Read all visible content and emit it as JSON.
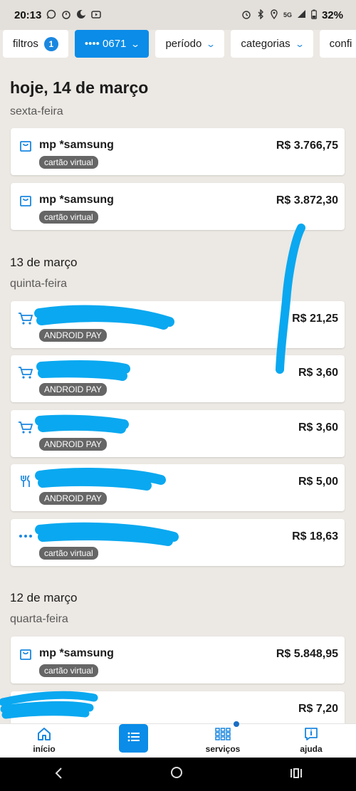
{
  "status_bar": {
    "time": "20:13",
    "network": "5G",
    "battery": "32%"
  },
  "filters": [
    {
      "label": "filtros",
      "count": "1"
    },
    {
      "label": "•••• 0671"
    },
    {
      "label": "período"
    },
    {
      "label": "categorias"
    },
    {
      "label": "confi"
    }
  ],
  "days": [
    {
      "title": "hoje, 14 de março",
      "weekday": "sexta-feira",
      "transactions": [
        {
          "icon": "shopping-bag-icon",
          "merchant": "mp *samsung",
          "amount": "R$ 3.766,75",
          "tag": "cartão virtual"
        },
        {
          "icon": "shopping-bag-icon",
          "merchant": "mp *samsung",
          "amount": "R$ 3.872,30",
          "tag": "cartão virtual"
        }
      ]
    },
    {
      "title": "13 de março",
      "weekday": "quinta-feira",
      "transactions": [
        {
          "icon": "shopping-cart-icon",
          "merchant": "",
          "amount": "R$ 21,25",
          "tag": "ANDROID PAY"
        },
        {
          "icon": "shopping-cart-icon",
          "merchant": "",
          "amount": "R$ 3,60",
          "tag": "ANDROID PAY"
        },
        {
          "icon": "shopping-cart-icon",
          "merchant": "",
          "amount": "R$ 3,60",
          "tag": "ANDROID PAY"
        },
        {
          "icon": "fork-knife-icon",
          "merchant": "",
          "amount": "R$ 5,00",
          "tag": "ANDROID PAY"
        },
        {
          "icon": "more-dots-icon",
          "merchant": "",
          "amount": "R$ 18,63",
          "tag": "cartão virtual"
        }
      ]
    },
    {
      "title": "12 de março",
      "weekday": "quarta-feira",
      "transactions": [
        {
          "icon": "shopping-bag-icon",
          "merchant": "mp *samsung",
          "amount": "R$ 5.848,95",
          "tag": "cartão virtual"
        },
        {
          "icon": "",
          "merchant": "",
          "amount": "R$ 7,20",
          "tag": ""
        }
      ]
    }
  ],
  "bottom_nav": [
    {
      "label": "início",
      "icon": "home-icon"
    },
    {
      "label": "",
      "icon": "list-icon"
    },
    {
      "label": "serviços",
      "icon": "grid-icon"
    },
    {
      "label": "ajuda",
      "icon": "help-icon"
    }
  ],
  "colors": {
    "accent": "#0a8ce8",
    "background": "#ece8e3",
    "tag": "#666666",
    "scribble": "#0aa8f0"
  }
}
